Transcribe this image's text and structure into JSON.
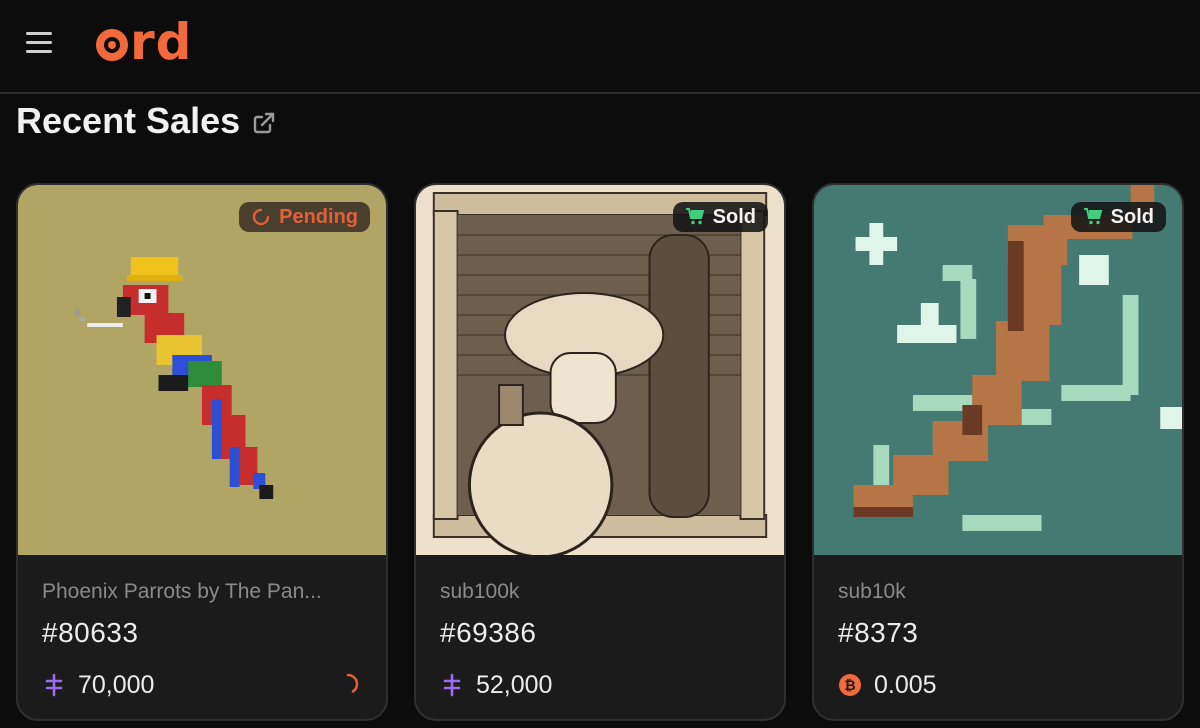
{
  "header": {
    "logo_text": "rd",
    "menu_icon": "hamburger-icon"
  },
  "section": {
    "title": "Recent Sales",
    "link_icon": "external-link-icon"
  },
  "cards": [
    {
      "status": "Pending",
      "status_icon": "loading-spinner-icon",
      "collection": "Phoenix Parrots by The Pan...",
      "number": "#80633",
      "price": "70,000",
      "currency_icon": "rune-currency-icon",
      "art": "pixel-parrot-with-hardhat-and-cigarette"
    },
    {
      "status": "Sold",
      "status_icon": "cart-icon",
      "collection": "sub100k",
      "number": "#69386",
      "price": "52,000",
      "currency_icon": "rune-currency-icon",
      "art": "ink-drawing-mushroom-warrior-in-window"
    },
    {
      "status": "Sold",
      "status_icon": "cart-icon",
      "collection": "sub10k",
      "number": "#8373",
      "price": "0.005",
      "currency_icon": "bitcoin-icon",
      "art": "pixel-branch-with-sparkles"
    }
  ],
  "colors": {
    "accent": "#f26a3b",
    "rune_purple": "#9b6cf0",
    "cart_green": "#3fcf7e",
    "bitcoin_orange": "#f26a3b"
  }
}
